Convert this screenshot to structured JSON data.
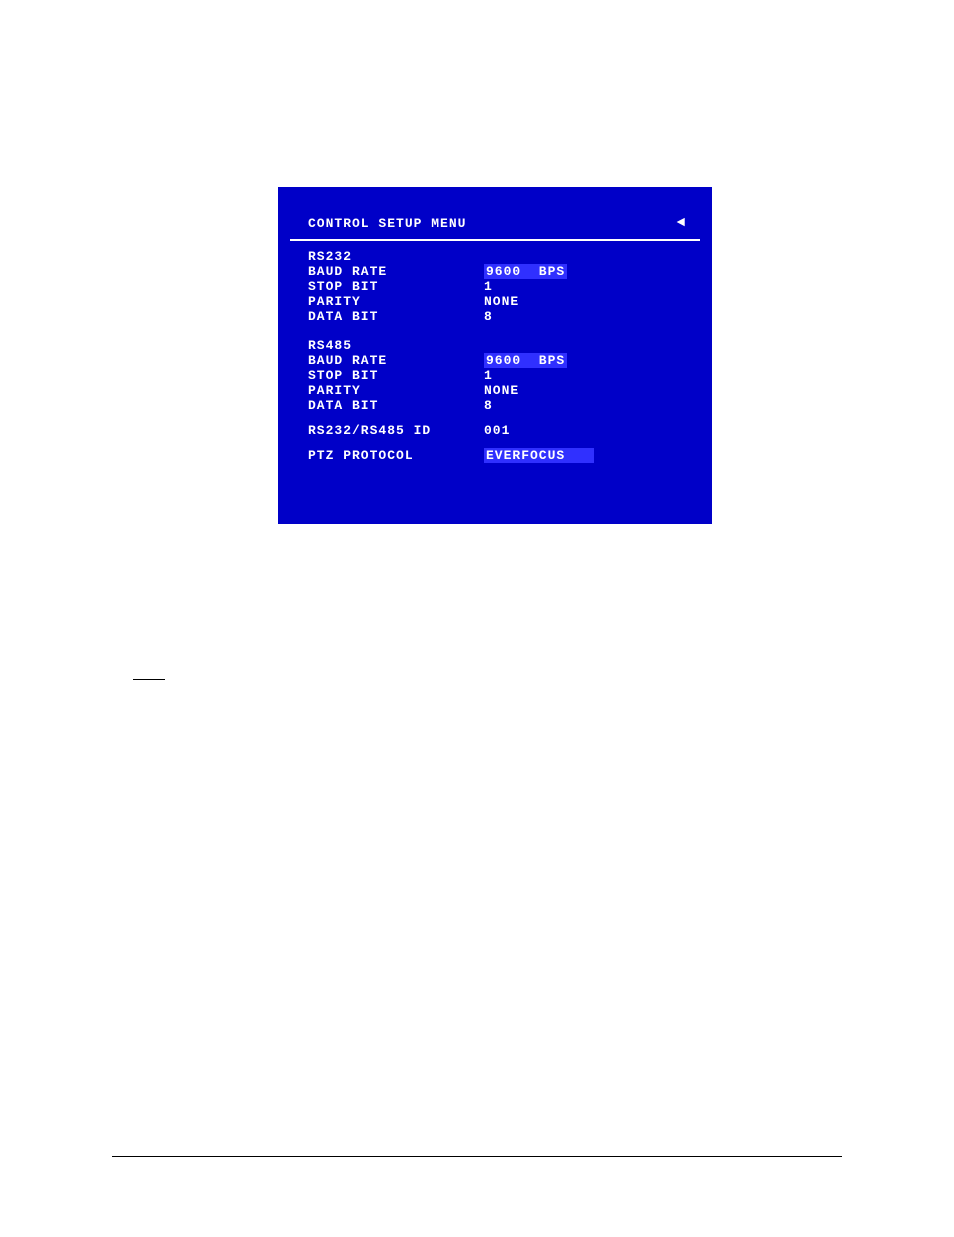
{
  "menu": {
    "title": "CONTROL SETUP MENU",
    "back_symbol": "◄"
  },
  "rs232": {
    "label": "RS232",
    "baud_rate_label": "BAUD RATE",
    "baud_rate_value": "9600  BPS",
    "stop_bit_label": "STOP BIT",
    "stop_bit_value": "1",
    "parity_label": "PARITY",
    "parity_value": "NONE",
    "data_bit_label": "DATA BIT",
    "data_bit_value": "8"
  },
  "rs485": {
    "label": "RS485",
    "baud_rate_label": "BAUD RATE",
    "baud_rate_value": "9600  BPS",
    "stop_bit_label": "STOP BIT",
    "stop_bit_value": "1",
    "parity_label": "PARITY",
    "parity_value": "NONE",
    "data_bit_label": "DATA BIT",
    "data_bit_value": "8"
  },
  "id": {
    "label": "RS232/RS485 ID",
    "value": "001"
  },
  "ptz": {
    "label": "PTZ PROTOCOL",
    "value": "EVERFOCUS   "
  }
}
